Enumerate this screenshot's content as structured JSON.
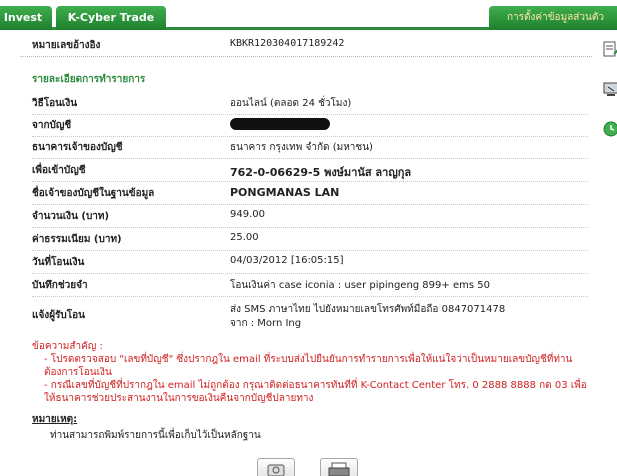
{
  "tabs": {
    "invest": "Invest",
    "kcyber": "K-Cyber Trade",
    "settings": "การตั้งค่าข้อมูลส่วนตัว"
  },
  "reference": {
    "label": "หมายเลขอ้างอิง",
    "value": "KBKR120304017189242"
  },
  "section_title": "รายละเอียดการทำรายการ",
  "rows": [
    {
      "label": "วิธีโอนเงิน",
      "value": "ออนไลน์ (ตลอด 24 ชั่วโมง)"
    },
    {
      "label": "จากบัญชี",
      "value": ""
    },
    {
      "label": "ธนาคารเจ้าของบัญชี",
      "value": "ธนาคาร กรุงเทพ จำกัด (มหาชน)"
    },
    {
      "label": "เพื่อเข้าบัญชี",
      "value": "762-0-06629-5 พงษ์มานัส ลาญกุล"
    },
    {
      "label": "ชื่อเจ้าของบัญชีในฐานข้อมูล",
      "value": "PONGMANAS LAN"
    },
    {
      "label": "จำนวนเงิน (บาท)",
      "value": "949.00"
    },
    {
      "label": "ค่าธรรมเนียม (บาท)",
      "value": "25.00"
    },
    {
      "label": "วันที่โอนเงิน",
      "value": "04/03/2012 [16:05:15]"
    },
    {
      "label": "บันทึกช่วยจำ",
      "value": "โอนเงินค่า case iconia : user pipingeng 899+ ems 50"
    },
    {
      "label": "แจ้งผู้รับโอน",
      "value": "ส่ง SMS ภาษาไทย ไปยังหมายเลขโทรศัพท์มือถือ 0847071478",
      "value2": "จาก : Morn Ing"
    }
  ],
  "notice": {
    "title": "ข้อความสำคัญ :",
    "item1": "- โปรดตรวจสอบ \"เลขที่บัญชี\" ซึ่งปรากฎใน email ที่ระบบส่งไปยืนยันการทำรายการเพื่อให้แน่ใจว่าเป็นหมายเลขบัญชีที่ท่านต้องการโอนเงิน",
    "item2": "- กรณีเลขที่บัญชีที่ปรากฎใน email ไม่ถูกต้อง กรุณาติดต่อธนาคารทันทีที่ K-Contact Center โทร. 0 2888 8888 กด 03 เพื่อให้ธนาคารช่วยประสานงานในการขอเงินคืนจากบัญชีปลายทาง"
  },
  "remark": {
    "title": "หมายเหตุ:",
    "text": "ท่านสามารถพิมพ์รายการนี้เพื่อเก็บไว้เป็นหลักฐาน"
  },
  "colors": {
    "brand_green": "#2c8b3c",
    "notice_red": "#d12020"
  }
}
